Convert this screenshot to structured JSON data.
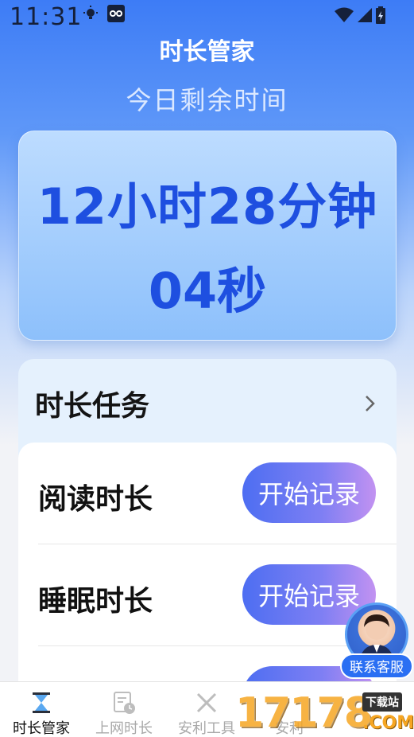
{
  "status_bar": {
    "time": "11:31"
  },
  "header": {
    "title": "时长管家",
    "subtitle": "今日剩余时间"
  },
  "timer": {
    "line1": "12小时28分钟",
    "line2": "04秒"
  },
  "tasks_panel": {
    "title": "时长任务",
    "items": [
      {
        "label": "阅读时长",
        "button": "开始记录"
      },
      {
        "label": "睡眠时长",
        "button": "开始记录"
      },
      {
        "label": "",
        "button": ""
      }
    ]
  },
  "customer_service": {
    "label": "联系客服"
  },
  "tabbar": {
    "tabs": [
      {
        "label": "时长管家",
        "icon": "hourglass-icon",
        "active": true
      },
      {
        "label": "上网时长",
        "icon": "browser-clock-icon",
        "active": false
      },
      {
        "label": "安利工具",
        "icon": "tools-icon",
        "active": false
      },
      {
        "label": "安利",
        "icon": "tab-icon",
        "active": false
      },
      {
        "label": "",
        "icon": "tab-icon",
        "active": false
      }
    ]
  },
  "watermark": {
    "number": "17178",
    "download": "下载站",
    "domain": ".COM"
  },
  "colors": {
    "primary": "#1e4fe0",
    "header_bg": "#3d7cf6",
    "button_gradient_start": "#4d6ef2",
    "button_gradient_end": "#c292f1",
    "cs_label_bg": "#2a6ff3"
  }
}
